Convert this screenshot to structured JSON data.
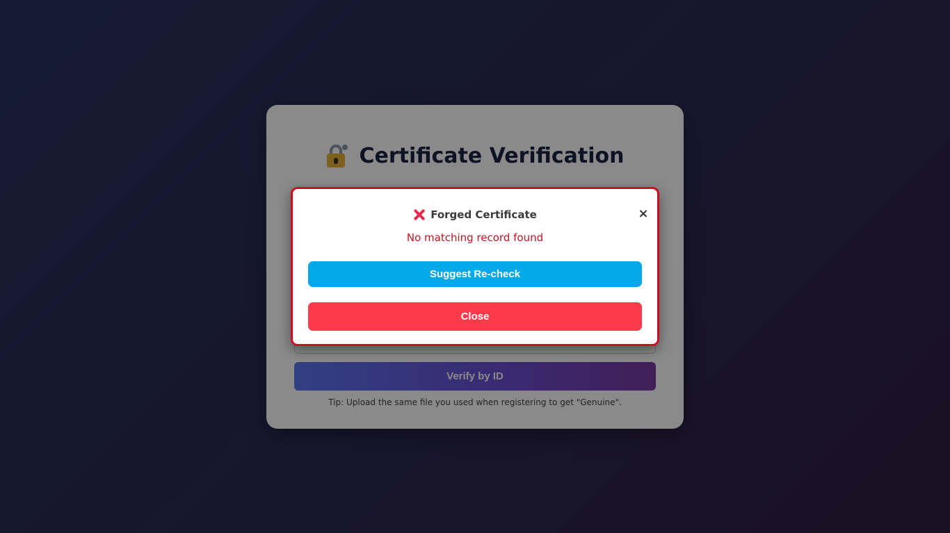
{
  "card": {
    "title": "Certificate Verification",
    "verify_button_label": "Verify by ID",
    "tip": "Tip: Upload the same file you used when registering to get \"Genuine\"."
  },
  "modal": {
    "title": "Forged Certificate",
    "message": "No matching record found",
    "close_icon": "×",
    "suggest_button_label": "Suggest Re-check",
    "close_button_label": "Close",
    "accent_color": "#d30b21"
  },
  "icons": {
    "title_icon": "lock-with-key-icon",
    "status_icon": "cross-mark-icon",
    "dismiss_icon": "close-icon"
  },
  "colors": {
    "suggest_button": "#02a8e8",
    "close_button": "#fc3a4b",
    "message_text": "#c41424"
  }
}
